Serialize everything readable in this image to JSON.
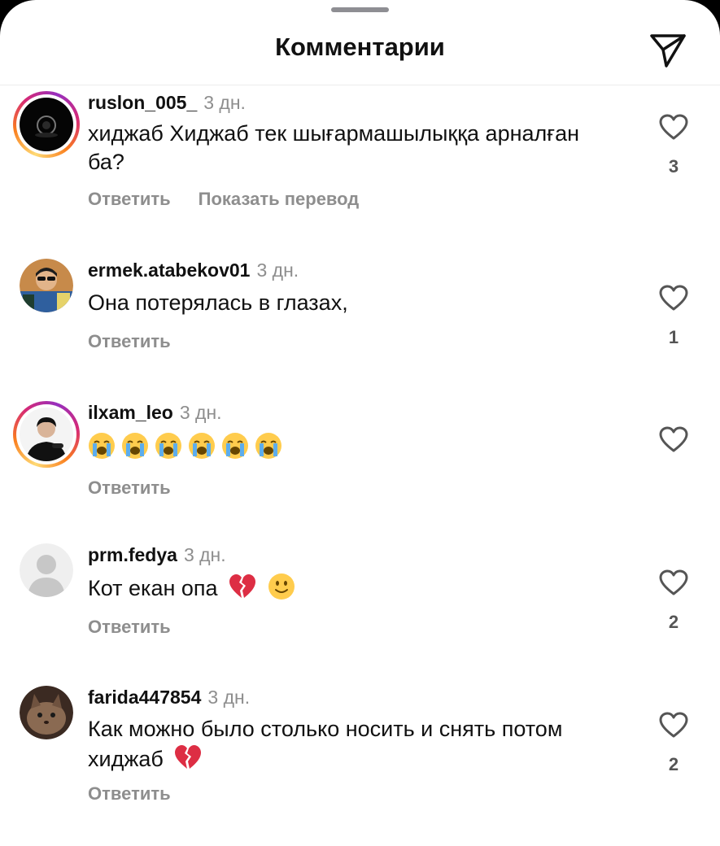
{
  "header": {
    "title": "Комментарии",
    "share_icon": "paper-plane-icon"
  },
  "actions": {
    "reply_label": "Ответить",
    "translate_label": "Показать перевод"
  },
  "colors": {
    "background": "#ffffff",
    "muted_text": "#8e8e8e",
    "primary_text": "#111111"
  },
  "comments": [
    {
      "username": "ruslon_005_",
      "time": "3 дн.",
      "text": "хиджаб Хиджаб тек шығармашылыққа арналған ба?",
      "likes": "3",
      "has_story_ring": true,
      "emojis": []
    },
    {
      "username": "ermek.atabekov01",
      "time": "3 дн.",
      "text": "Она потерялась в глазах,",
      "likes": "1",
      "has_story_ring": false,
      "emojis": []
    },
    {
      "username": "ilxam_leo",
      "time": "3 дн.",
      "text": "",
      "likes": "",
      "has_story_ring": true,
      "emojis": [
        "loudly-crying-face",
        "loudly-crying-face",
        "loudly-crying-face",
        "loudly-crying-face",
        "loudly-crying-face",
        "loudly-crying-face"
      ]
    },
    {
      "username": "prm.fedya",
      "time": "3 дн.",
      "text": "Кот екан опа",
      "likes": "2",
      "has_story_ring": false,
      "emojis": [
        "broken-heart",
        "slightly-smiling-face"
      ]
    },
    {
      "username": "farida447854",
      "time": "3 дн.",
      "text": "Как можно было столько носить и снять потом хиджаб",
      "likes": "2",
      "has_story_ring": false,
      "emojis": [
        "broken-heart"
      ]
    }
  ]
}
